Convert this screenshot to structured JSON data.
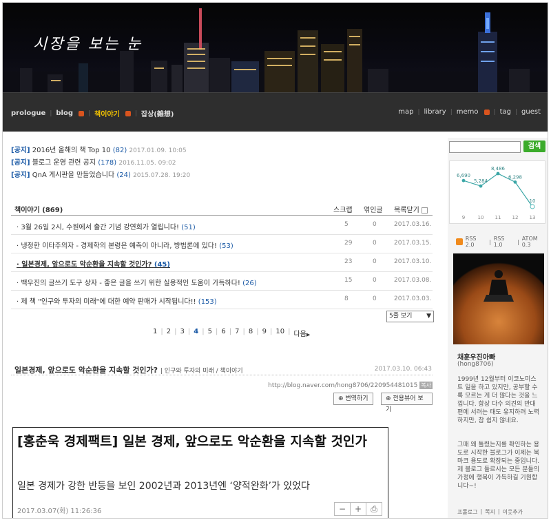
{
  "header": {
    "title": "시장을 보는 눈"
  },
  "nav": {
    "left": [
      {
        "label": "prologue",
        "active": false,
        "icon": false
      },
      {
        "label": "blog",
        "active": false,
        "icon": true
      },
      {
        "label": "책이야기",
        "active": true,
        "icon": true
      },
      {
        "label": "잡상(雜想)",
        "active": false,
        "icon": false
      }
    ],
    "right": [
      {
        "label": "map",
        "icon": false
      },
      {
        "label": "library",
        "icon": false
      },
      {
        "label": "memo",
        "icon": true
      },
      {
        "label": "tag",
        "icon": false
      },
      {
        "label": "guest",
        "icon": false
      }
    ]
  },
  "notices": [
    {
      "tag": "[공지]",
      "title": "2016년 올해의 책 Top 10",
      "count": "(82)",
      "date": "2017.01.09. 10:05"
    },
    {
      "tag": "[공지]",
      "title": "블로그 운영 관련 공지",
      "count": "(178)",
      "date": "2016.11.05. 09:02"
    },
    {
      "tag": "[공지]",
      "title": "QnA 게시판을 만들었습니다",
      "count": "(24)",
      "date": "2015.07.28. 19:20"
    }
  ],
  "list": {
    "header": {
      "category": "책이야기 (869)",
      "scrap": "스크랩",
      "trackback": "엮인글",
      "fold": "목록닫기"
    },
    "rows": [
      {
        "title": "3월 26일 2시, 수원에서 출간 기념 강연회가 열립니다!",
        "count": "(51)",
        "scrap": "5",
        "trackback": "0",
        "date": "2017.03.16.",
        "bold": false
      },
      {
        "title": "냉정한 이타주의자 - 경제학의 본령은 예측이 아니라, 방법론에 있다!",
        "count": "(53)",
        "scrap": "29",
        "trackback": "0",
        "date": "2017.03.15.",
        "bold": false
      },
      {
        "title": "일본경제, 앞으로도 악순환을 지속할 것인가?",
        "count": "(45)",
        "scrap": "23",
        "trackback": "0",
        "date": "2017.03.10.",
        "bold": true
      },
      {
        "title": "백우진의 글쓰기 도구 상자 - 좋은 글을 쓰기 위한 실용적인 도움이 가득하다!",
        "count": "(26)",
        "scrap": "15",
        "trackback": "0",
        "date": "2017.03.08.",
        "bold": false
      },
      {
        "title": "제 책 \"인구와 투자의 미래\"에 대한 예약 판매가 시작됩니다!!",
        "count": "(153)",
        "scrap": "8",
        "trackback": "0",
        "date": "2017.03.03.",
        "bold": false
      }
    ]
  },
  "perpage": "5줄 보기",
  "pager": {
    "pages": [
      "1",
      "2",
      "3",
      "4",
      "5",
      "6",
      "7",
      "8",
      "9",
      "10"
    ],
    "current": "4",
    "next": "다음"
  },
  "post": {
    "title": "일본경제, 앞으로도 악순환을 지속할 것인가?",
    "category": "인구와 투자의 미래 / 책이야기",
    "date": "2017.03.10. 06:43",
    "url": "http://blog.naver.com/hong8706/220954481015",
    "url_badge": "복사",
    "translate_btn": "번역하기",
    "viewer_btn": "전용뷰어 보기"
  },
  "article": {
    "headline": "[홍춘욱 경제팩트] 일본 경제, 앞으로도 악순환을 지속할 것인가",
    "subhead": "일본 경제가 강한 반등을 보인 2002년과 2013년엔 ‘양적완화’가 있었다",
    "date": "2017.03.07(화) 11:26:36"
  },
  "sidebar": {
    "search_placeholder": "",
    "search_btn": "검색",
    "rss": [
      "RSS 2.0",
      "RSS 1.0",
      "ATOM 0.3"
    ],
    "profile_name": "채훈우진아빠",
    "profile_id": "(hong8706)",
    "desc1": "1999년 12월부터 이코노미스트 일을 하고 있지만, 공부할 수록 모르는 게 더 많다는 것을 느낍니다. 항상 다수 의견의 반대 편에 서려는 태도 유지하려 노력하지만, 참 쉽지 않네요.",
    "desc2": "그때 왜 틀렸는지를 확인하는 용도로 시작한 블로그가 이제는 북마크 용도로 확장되는 중입니다. 제 블로그 들르시는 모든 분들의 가정에 행복이 가득하길 기원합니다~!",
    "links": [
      "프롤로그",
      "쪽지",
      "이웃추가"
    ]
  },
  "chart_data": {
    "type": "line",
    "categories": [
      "9",
      "10",
      "11",
      "12",
      "13"
    ],
    "values": [
      6690,
      5284,
      8486,
      6298,
      10
    ],
    "labels": [
      "6,690",
      "5,284",
      "8,486",
      "6,298",
      "10"
    ],
    "colors": {
      "line": "#3aa6a6",
      "last": "#6cc4c4"
    }
  }
}
